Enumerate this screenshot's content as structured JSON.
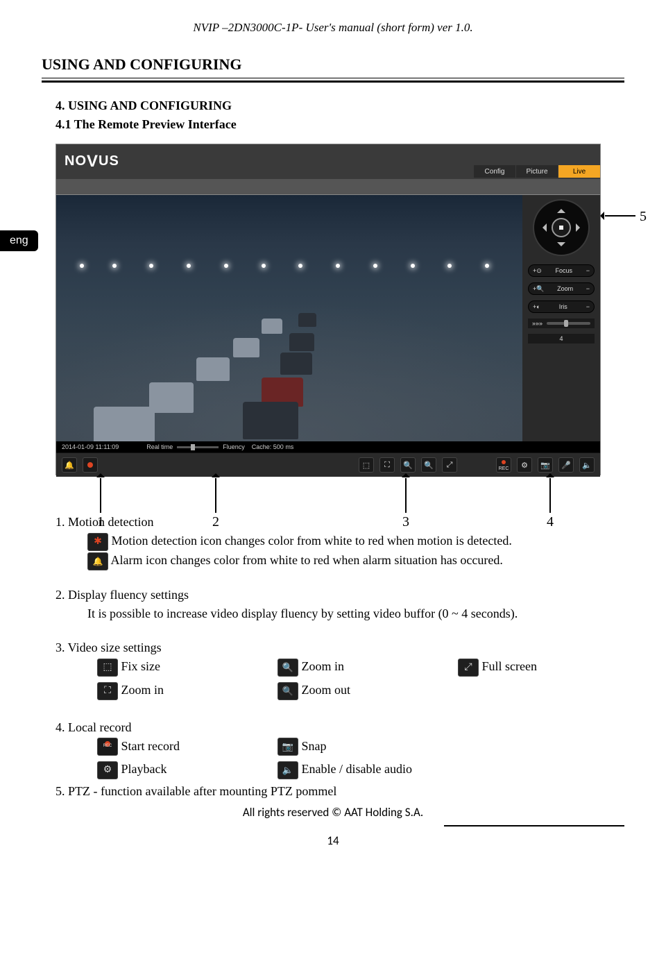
{
  "header": {
    "title": "NVIP –2DN3000C-1P- User's manual (short form) ver 1.0."
  },
  "lang_badge": "eng",
  "section_title": "USING AND CONFIGURING",
  "subheads": {
    "num": "4. USING AND CONFIGURING",
    "sub": "4.1 The Remote Preview Interface"
  },
  "screenshot": {
    "logo": "NOVUS",
    "tabs": [
      "Config",
      "Picture",
      "Live"
    ],
    "ptz": {
      "focus": "Focus",
      "zoom": "Zoom",
      "iris": "Iris",
      "plus": "+",
      "minus": "−",
      "arrows": "»»»",
      "speed_num": "4"
    },
    "status": {
      "timestamp": "2014-01-09 11:11:09",
      "realtime": "Real time",
      "fluency": "Fluency",
      "cache": "Cache: 500 ms"
    },
    "iconbar": {
      "rec": "REC"
    }
  },
  "callouts": {
    "n1": "1",
    "n2": "2",
    "n3": "3",
    "n4": "4",
    "n5": "5"
  },
  "body": {
    "s1": {
      "title": "1. Motion detection",
      "line1": "Motion detection icon changes color from white to red when motion is detected.",
      "line2": "Alarm icon changes color from white to red when alarm situation has occured."
    },
    "s2": {
      "title": "2. Display fluency settings",
      "line1": "It is possible to increase video display fluency by setting video buffor (0 ~ 4 seconds)."
    },
    "s3": {
      "title": "3. Video size settings",
      "fixsize": "Fix size",
      "zoomin_top": "Zoom in",
      "fullscreen": "Full screen",
      "zoomin_bottom": "Zoom in",
      "zoomout": "Zoom out"
    },
    "s4": {
      "title": "4. Local record",
      "start": "Start record",
      "snap": "Snap",
      "playback": "Playback",
      "audio": "Enable / disable audio"
    },
    "s5": {
      "line": "5. PTZ - function available after mounting PTZ pommel"
    }
  },
  "footer": {
    "rights": "All rights reserved © AAT Holding S.A.",
    "pagenum": "14"
  }
}
